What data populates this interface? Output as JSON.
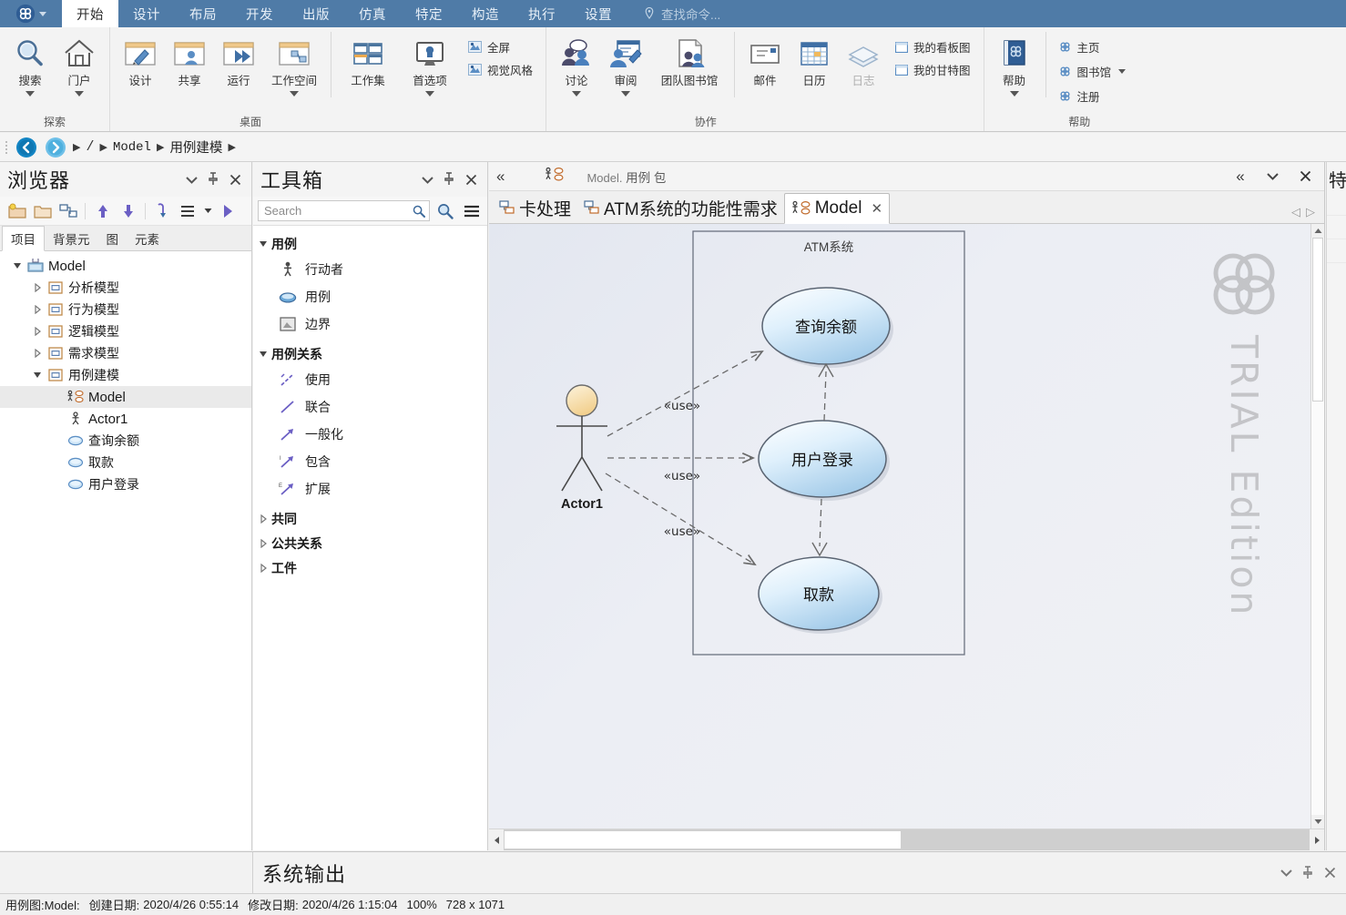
{
  "ribbon": {
    "tabs": [
      {
        "label": "开始",
        "active": true
      },
      {
        "label": "设计",
        "active": false
      },
      {
        "label": "布局",
        "active": false
      },
      {
        "label": "开发",
        "active": false
      },
      {
        "label": "出版",
        "active": false
      },
      {
        "label": "仿真",
        "active": false
      },
      {
        "label": "特定",
        "active": false
      },
      {
        "label": "构造",
        "active": false
      },
      {
        "label": "执行",
        "active": false
      },
      {
        "label": "设置",
        "active": false
      }
    ],
    "search_placeholder": "查找命令...",
    "groups": [
      {
        "name": "探索",
        "buttons": [
          {
            "label": "搜索",
            "icon": "magnifier-icon",
            "dropdown": true
          },
          {
            "label": "门户",
            "icon": "home-icon",
            "dropdown": true
          }
        ]
      },
      {
        "name": "桌面",
        "buttons": [
          {
            "label": "设计",
            "icon": "window-pencil-icon",
            "dropdown": false
          },
          {
            "label": "共享",
            "icon": "window-person-icon",
            "dropdown": false
          },
          {
            "label": "运行",
            "icon": "window-play-icon",
            "dropdown": false
          },
          {
            "label": "工作空间",
            "icon": "window-shapes-icon",
            "dropdown": true
          },
          {
            "label": "工作集",
            "icon": "grid-panes-icon",
            "dropdown": false
          },
          {
            "label": "首选项",
            "icon": "monitor-wrench-icon",
            "dropdown": true
          }
        ],
        "small_items": [
          {
            "label": "全屏",
            "icon": "fullscreen-icon"
          },
          {
            "label": "视觉风格",
            "icon": "visual-style-icon"
          }
        ]
      },
      {
        "name": "协作",
        "buttons": [
          {
            "label": "讨论",
            "icon": "discuss-icon",
            "dropdown": true
          },
          {
            "label": "审阅",
            "icon": "review-icon",
            "dropdown": true
          },
          {
            "label": "团队图书馆",
            "icon": "team-library-icon",
            "dropdown": false
          },
          {
            "label": "邮件",
            "icon": "mail-icon",
            "dropdown": false
          },
          {
            "label": "日历",
            "icon": "calendar-icon",
            "dropdown": false
          },
          {
            "label": "日志",
            "icon": "journal-icon",
            "dropdown": false,
            "disabled": true
          }
        ],
        "small_items": [
          {
            "label": "我的看板图",
            "icon": "kanban-icon"
          },
          {
            "label": "我的甘特图",
            "icon": "gantt-icon"
          }
        ]
      },
      {
        "name": "帮助",
        "buttons": [
          {
            "label": "帮助",
            "icon": "help-book-icon",
            "dropdown": true
          }
        ],
        "small_items": [
          {
            "label": "主页",
            "icon": "ea-logo-icon"
          },
          {
            "label": "图书馆",
            "icon": "ea-logo-icon",
            "dropdown": true
          },
          {
            "label": "注册",
            "icon": "ea-logo-icon"
          }
        ]
      }
    ]
  },
  "breadcrumb": {
    "back_icon": "back-arrow-icon",
    "forward_icon": "forward-arrow-icon",
    "root": "/",
    "items": [
      "Model",
      "用例建模"
    ]
  },
  "browser": {
    "title": "浏览器",
    "toolbar_icons": [
      "new-package-icon",
      "open-folder-icon",
      "new-diagram-icon",
      "move-up-icon",
      "move-down-icon",
      "select-element-icon",
      "menu-lines-icon",
      "run-icon"
    ],
    "tabs": [
      {
        "label": "项目",
        "active": true
      },
      {
        "label": "背景元",
        "active": false
      },
      {
        "label": "图",
        "active": false
      },
      {
        "label": "元素",
        "active": false
      }
    ],
    "tree": [
      {
        "label": "Model",
        "indent": 0,
        "icon": "model-root-icon",
        "twisty": "expanded",
        "selected": false
      },
      {
        "label": "分析模型",
        "indent": 1,
        "icon": "package-icon",
        "twisty": "collapsed",
        "selected": false
      },
      {
        "label": "行为模型",
        "indent": 1,
        "icon": "package-icon",
        "twisty": "collapsed",
        "selected": false
      },
      {
        "label": "逻辑模型",
        "indent": 1,
        "icon": "package-icon",
        "twisty": "collapsed",
        "selected": false
      },
      {
        "label": "需求模型",
        "indent": 1,
        "icon": "package-icon",
        "twisty": "collapsed",
        "selected": false
      },
      {
        "label": "用例建模",
        "indent": 1,
        "icon": "package-icon",
        "twisty": "expanded",
        "selected": false
      },
      {
        "label": "Model",
        "indent": 2,
        "icon": "usecase-diagram-icon",
        "twisty": "none",
        "selected": true
      },
      {
        "label": "Actor1",
        "indent": 2,
        "icon": "actor-icon",
        "twisty": "none",
        "selected": false
      },
      {
        "label": "查询余额",
        "indent": 2,
        "icon": "usecase-icon",
        "twisty": "none",
        "selected": false
      },
      {
        "label": "取款",
        "indent": 2,
        "icon": "usecase-icon",
        "twisty": "none",
        "selected": false
      },
      {
        "label": "用户登录",
        "indent": 2,
        "icon": "usecase-icon",
        "twisty": "none",
        "selected": false
      }
    ]
  },
  "toolbox": {
    "title": "工具箱",
    "search_placeholder": "Search",
    "groups": [
      {
        "label": "用例",
        "expanded": true,
        "items": [
          {
            "label": "行动者",
            "icon": "actor-icon"
          },
          {
            "label": "用例",
            "icon": "usecase-icon"
          },
          {
            "label": "边界",
            "icon": "boundary-icon"
          }
        ]
      },
      {
        "label": "用例关系",
        "expanded": true,
        "items": [
          {
            "label": "使用",
            "icon": "use-relation-icon"
          },
          {
            "label": "联合",
            "icon": "associate-relation-icon"
          },
          {
            "label": "一般化",
            "icon": "generalize-relation-icon"
          },
          {
            "label": "包含",
            "icon": "include-relation-icon"
          },
          {
            "label": "扩展",
            "icon": "extend-relation-icon"
          }
        ]
      },
      {
        "label": "共同",
        "expanded": false,
        "items": []
      },
      {
        "label": "公共关系",
        "expanded": false,
        "items": []
      },
      {
        "label": "工件",
        "expanded": false,
        "items": []
      }
    ]
  },
  "diagram_view": {
    "path_prefix": "Model.",
    "path_suffix": "用例 包",
    "tabs": [
      {
        "label": "卡处理",
        "icon": "diagram-icon",
        "active": false
      },
      {
        "label": "ATM系统的功能性需求",
        "icon": "diagram-icon",
        "active": false
      },
      {
        "label": "Model",
        "icon": "usecase-diagram-icon",
        "active": true,
        "closable": true
      }
    ],
    "watermark": "TRIAL Edition"
  },
  "diagram": {
    "boundary_label": "ATM系统",
    "actor": {
      "label": "Actor1"
    },
    "usecases": [
      {
        "id": "uc1",
        "label": "查询余额"
      },
      {
        "id": "uc2",
        "label": "用户登录"
      },
      {
        "id": "uc3",
        "label": "取款"
      }
    ],
    "connections": [
      {
        "from": "Actor1",
        "to": "查询余额",
        "stereotype": "«use»"
      },
      {
        "from": "Actor1",
        "to": "用户登录",
        "stereotype": "«use»"
      },
      {
        "from": "Actor1",
        "to": "取款",
        "stereotype": "«use»"
      },
      {
        "from": "用户登录",
        "to": "查询余额",
        "stereotype": ""
      },
      {
        "from": "用户登录",
        "to": "取款",
        "stereotype": ""
      }
    ]
  },
  "output": {
    "title": "系统输出"
  },
  "status": {
    "diagram_label": "用例图:Model:",
    "created_label": "创建日期:",
    "created_value": "2020/4/26 0:55:14",
    "modified_label": "修改日期:",
    "modified_value": "2020/4/26 1:15:04",
    "zoom": "100%",
    "size": "728 x 1071"
  },
  "colors": {
    "ribbon_blue": "#4f7ba7",
    "usecase_fill": "#bcdcf5",
    "actor_head": "#f5dfae",
    "canvas": "#e9ecf4"
  }
}
